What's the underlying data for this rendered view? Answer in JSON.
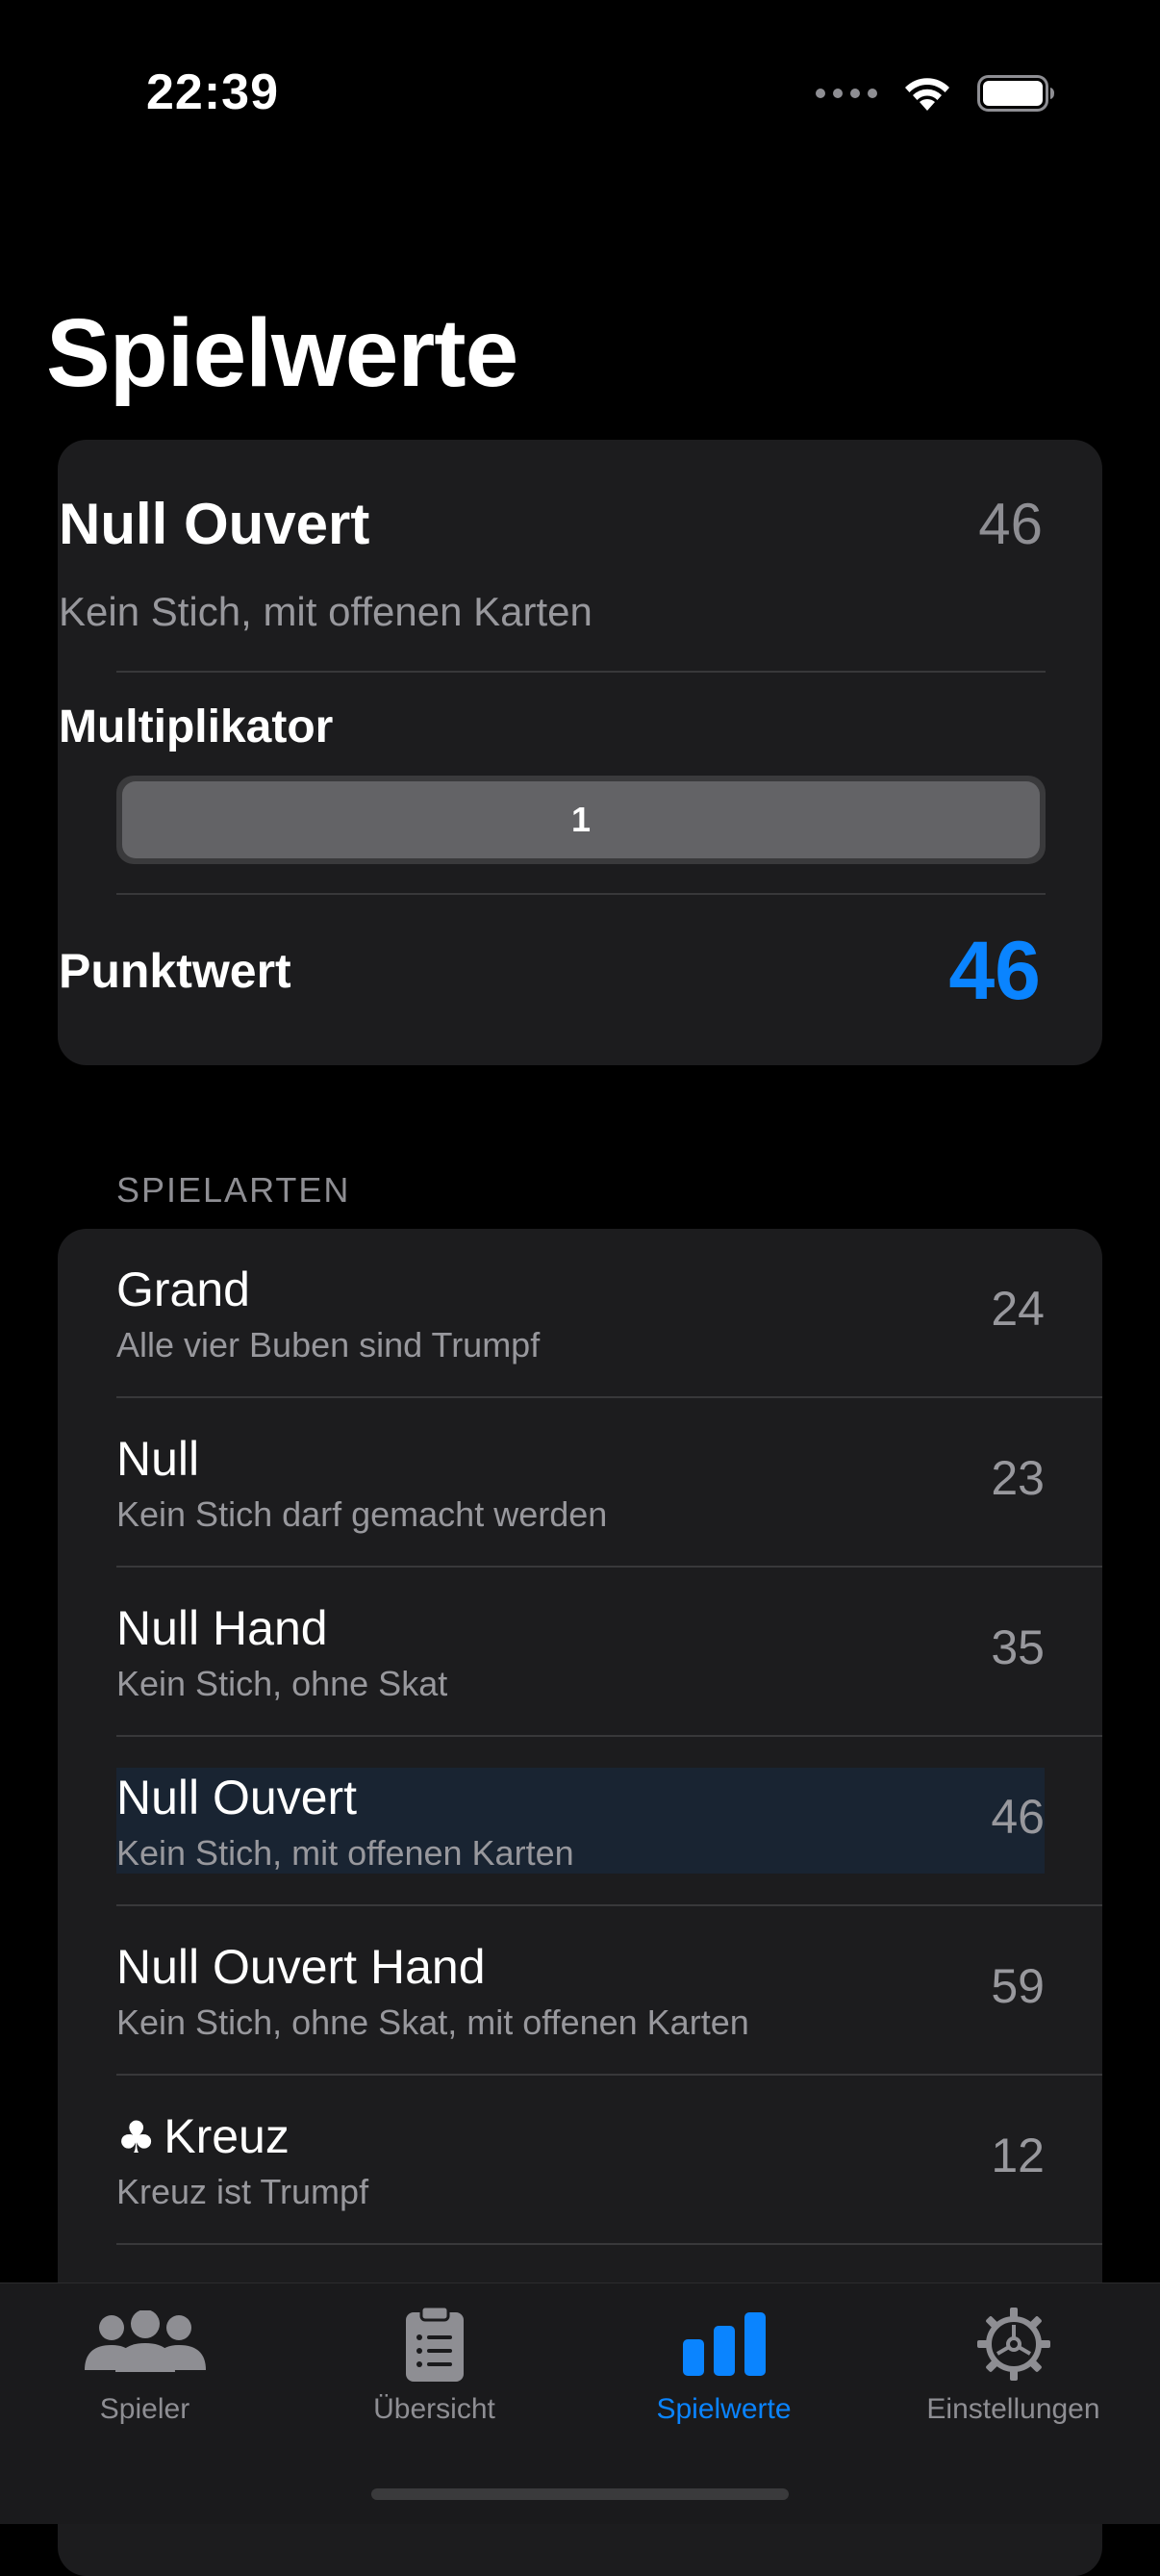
{
  "status_bar": {
    "time": "22:39"
  },
  "page": {
    "title": "Spielwerte"
  },
  "detail": {
    "title": "Null Ouvert",
    "base_value": "46",
    "description": "Kein Stich, mit offenen Karten",
    "multiplier_label": "Multiplikator",
    "multiplier_value": "1",
    "points_label": "Punktwert",
    "points_value": "46"
  },
  "section": {
    "header": "SPIELARTEN"
  },
  "game_types": [
    {
      "title": "Grand",
      "subtitle": "Alle vier Buben sind Trumpf",
      "value": "24",
      "selected": false
    },
    {
      "title": "Null",
      "subtitle": "Kein Stich darf gemacht werden",
      "value": "23",
      "selected": false
    },
    {
      "title": "Null Hand",
      "subtitle": "Kein Stich, ohne Skat",
      "value": "35",
      "selected": false
    },
    {
      "title": "Null Ouvert",
      "subtitle": "Kein Stich, mit offenen Karten",
      "value": "46",
      "selected": true
    },
    {
      "title": "Null Ouvert Hand",
      "subtitle": "Kein Stich, ohne Skat, mit offenen Karten",
      "value": "59",
      "selected": false
    },
    {
      "title": "Kreuz",
      "symbol": "♣",
      "subtitle": "Kreuz ist Trumpf",
      "value": "12",
      "selected": false
    }
  ],
  "tabs": [
    {
      "label": "Spieler",
      "icon": "people-icon",
      "active": false
    },
    {
      "label": "Übersicht",
      "icon": "clipboard-icon",
      "active": false
    },
    {
      "label": "Spielwerte",
      "icon": "bar-chart-icon",
      "active": true
    },
    {
      "label": "Einstellungen",
      "icon": "gear-icon",
      "active": false
    }
  ],
  "colors": {
    "accent": "#0a84ff",
    "background": "#000000",
    "card": "#1c1c1e",
    "secondary_text": "#98989d"
  }
}
